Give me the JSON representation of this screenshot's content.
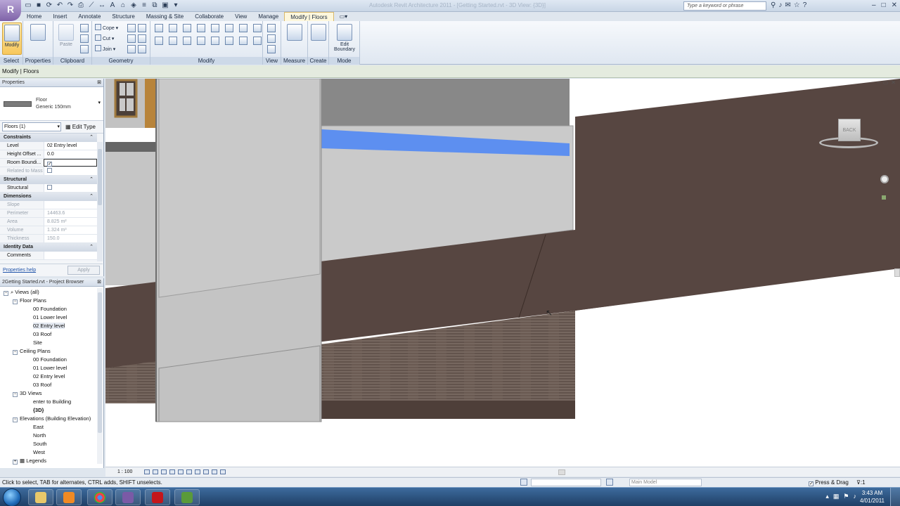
{
  "window": {
    "app_badge": "R",
    "doc_title": "Autodesk Revit Architecture 2011 - [Getting Started.rvt - 3D View: {3D}]",
    "search_placeholder": "Type a keyword or phrase"
  },
  "ribbon_tabs": [
    {
      "label": "Home"
    },
    {
      "label": "Insert"
    },
    {
      "label": "Annotate"
    },
    {
      "label": "Structure"
    },
    {
      "label": "Massing & Site"
    },
    {
      "label": "Collaborate"
    },
    {
      "label": "View"
    },
    {
      "label": "Manage"
    },
    {
      "label": "Modify | Floors"
    }
  ],
  "ribbon": {
    "modify_label": "Modify",
    "properties_label": "",
    "paste_label": "Paste",
    "cope_label": "Cope",
    "cut_label": "Cut",
    "join_label": "Join",
    "edit_boundary_label": "Edit Boundary",
    "panels": {
      "select": "Select",
      "properties": "Properties",
      "clipboard": "Clipboard",
      "geometry": "Geometry",
      "modify": "Modify",
      "view": "View",
      "measure": "Measure",
      "create": "Create",
      "mode": "Mode"
    }
  },
  "options_bar": {
    "text": "Modify | Floors"
  },
  "properties": {
    "title": "Properties",
    "type_family": "Floor",
    "type_name": "Generic 150mm",
    "instance_filter": "Floors (1)",
    "edit_type": "Edit Type",
    "groups": {
      "constraints": "Constraints",
      "structural": "Structural",
      "dimensions": "Dimensions",
      "identity": "Identity Data"
    },
    "rows": {
      "level_k": "Level",
      "level_v": "02 Entry level",
      "height_k": "Height Offset ...",
      "height_v": "0.0",
      "room_k": "Room Boundi...",
      "room_v": "✓",
      "related_k": "Related to Mass",
      "structural_k": "Structural",
      "slope_k": "Slope",
      "perimeter_k": "Perimeter",
      "perimeter_v": "14463.6",
      "area_k": "Area",
      "area_v": "8.825 m²",
      "volume_k": "Volume",
      "volume_v": "1.324 m³",
      "thickness_k": "Thickness",
      "thickness_v": "150.0",
      "comments_k": "Comments"
    },
    "help_link": "Properties help",
    "apply": "Apply"
  },
  "browser": {
    "title": "2Getting Started.rvt - Project Browser",
    "nodes": [
      {
        "label": "Views (all)"
      },
      {
        "label": "Floor Plans"
      },
      {
        "label": "00 Foundation"
      },
      {
        "label": "01 Lower level"
      },
      {
        "label": "02 Entry level"
      },
      {
        "label": "03 Roof"
      },
      {
        "label": "Site"
      },
      {
        "label": "Ceiling Plans"
      },
      {
        "label": "00 Foundation"
      },
      {
        "label": "01 Lower level"
      },
      {
        "label": "02 Entry level"
      },
      {
        "label": "03 Roof"
      },
      {
        "label": "3D Views"
      },
      {
        "label": "enter to Building"
      },
      {
        "label": "{3D}"
      },
      {
        "label": "Elevations (Building Elevation)"
      },
      {
        "label": "East"
      },
      {
        "label": "North"
      },
      {
        "label": "South"
      },
      {
        "label": "West"
      },
      {
        "label": "Legends"
      }
    ]
  },
  "canvas": {
    "viewcube_label": "BACK"
  },
  "viewbar": {
    "scale": "1 : 100"
  },
  "status": {
    "text": "Click to select, TAB for alternates, CTRL adds, SHIFT unselects.",
    "design_model": "Main Model",
    "press_drag": "Press & Drag",
    "filter_count": ":1"
  },
  "taskbar": {
    "time": "3:43 AM",
    "date": "4/01/2011"
  },
  "colors": {
    "floor_brown": "#574641",
    "wall_grey": "#bdbdbd",
    "highlight_blue": "#5d8ff0"
  }
}
